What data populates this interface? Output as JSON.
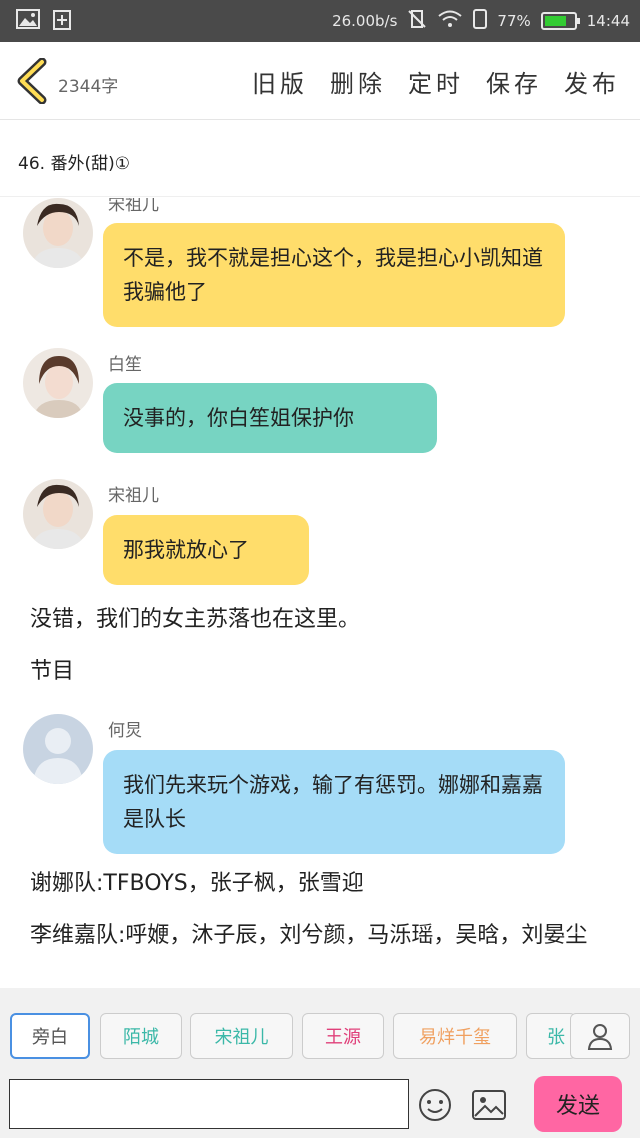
{
  "status_bar": {
    "speed": "26.00b/s",
    "battery_percent": "77%",
    "battery_level": 0.77,
    "battery_color": "#33cc33",
    "time": "14:44"
  },
  "toolbar": {
    "word_count": "2344字",
    "actions": [
      "旧版",
      "删除",
      "定时",
      "保存",
      "发布"
    ]
  },
  "chapter": {
    "title": "46. 番外(甜)①"
  },
  "messages": [
    {
      "speaker": "宋祖儿",
      "text": "不是，我不就是担心这个，我是担心小凯知道我骗他了",
      "color": "yellow"
    },
    {
      "speaker": "白笙",
      "text": "没事的，你白笙姐保护你",
      "color": "teal"
    },
    {
      "speaker": "宋祖儿",
      "text": "那我就放心了",
      "color": "yellow"
    },
    {
      "speaker": "何炅",
      "text": "我们先来玩个游戏，输了有惩罚。娜娜和嘉嘉是队长",
      "color": "blue"
    }
  ],
  "narration": [
    "没错，我们的女主苏落也在这里。",
    "节目",
    "谢娜队:TFBOYS，张子枫，张雪迎",
    "李维嘉队:呼㛹，沐子辰，刘兮颜，马泺瑶，吴晗，刘晏尘"
  ],
  "characters": [
    {
      "label": "旁白",
      "color": "#555555"
    },
    {
      "label": "陌城",
      "color": "#3bb8a8"
    },
    {
      "label": "宋祖儿",
      "color": "#3bb8a8"
    },
    {
      "label": "王源",
      "color": "#e0407a"
    },
    {
      "label": "易烊千玺",
      "color": "#f0a060"
    },
    {
      "label": "张",
      "color": "#3bb8a8"
    }
  ],
  "input": {
    "placeholder": "",
    "send_label": "发送"
  },
  "colors": {
    "send_button": "#ff66a3",
    "bubble_yellow": "#ffdd6b",
    "bubble_teal": "#77d4c2",
    "bubble_blue": "#a5dcf7"
  }
}
